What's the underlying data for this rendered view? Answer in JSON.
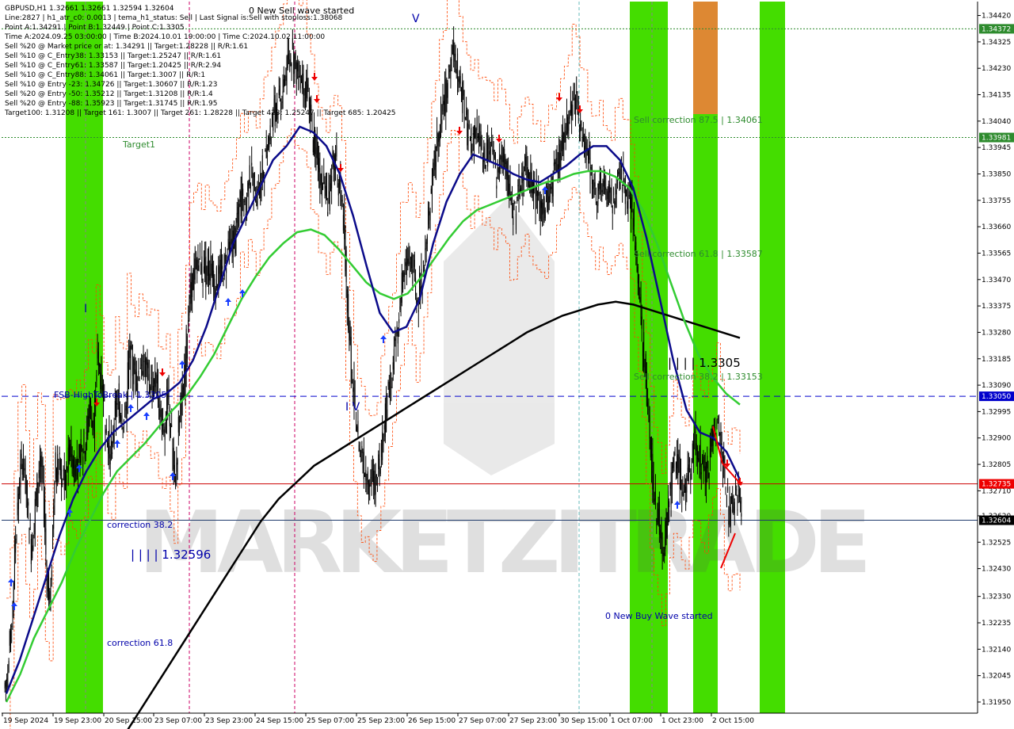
{
  "symbol_header": "GBPUSD,H1  1.32661 1.32661 1.32594 1.32604",
  "info_lines": [
    "Line:2827 | h1_atr_c0: 0.0013 | tema_h1_status: Sell | Last Signal is:Sell with stoploss:1.38068",
    "Point A:1.34291 | Point B:1.32449 | Point C:1.3305",
    "Time A:2024.09.25 03:00:00 | Time B:2024.10.01 19:00:00 | Time C:2024.10.02 11:00:00",
    "Sell %20 @ Market price or at: 1.34291 || Target:1.28228 || R/R:1.61",
    "Sell %10 @ C_Entry38: 1.33153 || Target:1.25247 || R/R:1.61",
    "Sell %10 @ C_Entry61: 1.33587 || Target:1.20425 || R/R:2.94",
    "Sell %10 @ C_Entry88: 1.34061 || Target:1.3007 || R/R:1",
    "Sell %10 @ Entry -23: 1.34726 || Target:1.30607 || R/R:1.23",
    "Sell %20 @ Entry -50: 1.35212 || Target:1.31208 || R/R:1.4",
    "Sell %20 @ Entry -88: 1.35923 || Target:1.31745 || R/R:1.95",
    "Target100: 1.31208 || Target 161: 1.3007 || Target 261: 1.28228 || Target 423: 1.25247 || Target 685: 1.20425"
  ],
  "annotations": {
    "sell_wave": "0 New Sell wave started",
    "buy_wave": "0 New Buy Wave started",
    "target1": "Target1",
    "sell_corr_875": "Sell correction 87.5 | 1.34061",
    "sell_corr_618": "Sell correction 61.8 | 1.33587",
    "sell_corr_382": "Sell correction 38.2 | 1.33153",
    "point_c_label": "| | | | 1.3305",
    "fsb_label": "FSB-HighToBreak | 1.3305",
    "corr_382": "correction 38.2",
    "corr_618": "correction 61.8",
    "low_label": "| | | | 1.32596",
    "wave_v": "V",
    "wave_iv": "I V",
    "wave_i": "I",
    "watermark": "MARKETZITRADE"
  },
  "colors": {
    "green_zone": "#44dd00",
    "orange_zone": "#dd8833",
    "ma_dark_blue": "#0b0b8a",
    "ma_green": "#33cc33",
    "ma_black": "#000000",
    "envelope_orange": "#ff4400",
    "price_line": "#cc0000",
    "fsb_line": "#0000cc",
    "bid_line": "#1f3a6b",
    "arrow_buy": "#1a3fff",
    "arrow_sell": "#ee0000"
  },
  "chart_data": {
    "type": "candlestick",
    "symbol": "GBPUSD",
    "timeframe": "H1",
    "ohlc_last": {
      "open": 1.32661,
      "high": 1.32661,
      "low": 1.32594,
      "close": 1.32604
    },
    "ylim": [
      1.3191,
      1.3447
    ],
    "y_ticks": [
      1.3442,
      1.34325,
      1.3423,
      1.34135,
      1.3404,
      1.33945,
      1.3385,
      1.33755,
      1.3366,
      1.33565,
      1.3347,
      1.33375,
      1.3328,
      1.33185,
      1.3309,
      1.32995,
      1.329,
      1.32805,
      1.3271,
      1.3262,
      1.32525,
      1.3243,
      1.3233,
      1.32235,
      1.3214,
      1.32045,
      1.3195
    ],
    "y_tick_labels": [
      "1.34420",
      "1.34325",
      "1.34230",
      "1.34135",
      "1.34040",
      "1.33945",
      "1.33850",
      "1.33755",
      "1.33660",
      "1.33565",
      "1.33470",
      "1.33375",
      "1.33280",
      "1.33185",
      "1.33090",
      "1.32995",
      "1.32900",
      "1.32805",
      "1.32710",
      "1.32620",
      "1.32525",
      "1.32430",
      "1.32330",
      "1.32235",
      "1.32140",
      "1.32045",
      "1.31950"
    ],
    "x_labels": [
      "19 Sep 2024",
      "19 Sep 23:00",
      "20 Sep 15:00",
      "23 Sep 07:00",
      "23 Sep 23:00",
      "24 Sep 15:00",
      "25 Sep 07:00",
      "25 Sep 23:00",
      "26 Sep 15:00",
      "27 Sep 07:00",
      "27 Sep 23:00",
      "30 Sep 15:00",
      "1 Oct 07:00",
      "1 Oct 23:00",
      "2 Oct 15:00"
    ],
    "price_tags": [
      {
        "label": "1.34372",
        "value": 1.34372,
        "color": "#2e8b2e"
      },
      {
        "label": "1.33981",
        "value": 1.33981,
        "color": "#2e8b2e"
      },
      {
        "label": "1.33050",
        "value": 1.3305,
        "color": "#0000cc"
      },
      {
        "label": "1.32735",
        "value": 1.32735,
        "color": "#ee0000"
      },
      {
        "label": "1.32604",
        "value": 1.32604,
        "color": "#000000"
      }
    ],
    "levels": {
      "target_upper": 1.34372,
      "target1": 1.33981,
      "fsb_high_to_break": 1.3305,
      "red_line": 1.32735,
      "bid": 1.32604
    },
    "swing_points": {
      "point_a": 1.34291,
      "point_b": 1.32449,
      "point_c": 1.3305
    },
    "closes": [
      1.3205,
      1.3225,
      1.3255,
      1.3275,
      1.3285,
      1.3265,
      1.325,
      1.3265,
      1.328,
      1.3275,
      1.324,
      1.3235,
      1.328,
      1.328,
      1.3275,
      1.3278,
      1.3285,
      1.328,
      1.3282,
      1.3285,
      1.329,
      1.33,
      1.3295,
      1.332,
      1.331,
      1.3295,
      1.3285,
      1.329,
      1.3305,
      1.33,
      1.3295,
      1.332,
      1.3315,
      1.331,
      1.3318,
      1.3316,
      1.3312,
      1.3308,
      1.331,
      1.33,
      1.3295,
      1.3305,
      1.329,
      1.3275,
      1.33,
      1.3305,
      1.333,
      1.3345,
      1.335,
      1.3355,
      1.3348,
      1.3352,
      1.335,
      1.3345,
      1.3348,
      1.335,
      1.3355,
      1.3358,
      1.3362,
      1.337,
      1.338,
      1.3375,
      1.3385,
      1.338,
      1.3378,
      1.3385,
      1.339,
      1.3398,
      1.3405,
      1.341,
      1.3412,
      1.342,
      1.3425,
      1.3428,
      1.3422,
      1.342,
      1.3418,
      1.341,
      1.34,
      1.3395,
      1.3385,
      1.338,
      1.3375,
      1.3385,
      1.339,
      1.338,
      1.337,
      1.334,
      1.3315,
      1.33,
      1.3285,
      1.328,
      1.3278,
      1.3275,
      1.3275,
      1.328,
      1.329,
      1.33,
      1.3312,
      1.332,
      1.333,
      1.3345,
      1.335,
      1.3355,
      1.335,
      1.334,
      1.3345,
      1.336,
      1.337,
      1.3385,
      1.3395,
      1.3405,
      1.3412,
      1.342,
      1.343,
      1.3425,
      1.3415,
      1.3405,
      1.34,
      1.3395,
      1.34,
      1.3395,
      1.339,
      1.3392,
      1.3395,
      1.3385,
      1.339,
      1.3392,
      1.3385,
      1.3375,
      1.337,
      1.338,
      1.3385,
      1.339,
      1.3382,
      1.3378,
      1.3375,
      1.3372,
      1.3375,
      1.338,
      1.3385,
      1.339,
      1.3395,
      1.34,
      1.3405,
      1.341,
      1.3408,
      1.34,
      1.3395,
      1.3388,
      1.338,
      1.3378,
      1.3382,
      1.338,
      1.3378,
      1.3375,
      1.338,
      1.3385,
      1.338,
      1.3375,
      1.337,
      1.3355,
      1.334,
      1.332,
      1.33,
      1.328,
      1.3265,
      1.326,
      1.325,
      1.3262,
      1.3275,
      1.3283,
      1.328,
      1.327,
      1.3272,
      1.328,
      1.329,
      1.3285,
      1.328,
      1.3278,
      1.3285,
      1.3292,
      1.3295,
      1.3285,
      1.327,
      1.3262,
      1.3265,
      1.327,
      1.326
    ],
    "dark_blue_ma": [
      1.3198,
      1.321,
      1.3225,
      1.324,
      1.3255,
      1.3268,
      1.3278,
      1.3286,
      1.3292,
      1.3296,
      1.33,
      1.3304,
      1.3306,
      1.331,
      1.3318,
      1.333,
      1.3345,
      1.336,
      1.337,
      1.338,
      1.339,
      1.3395,
      1.3402,
      1.34,
      1.3395,
      1.3385,
      1.337,
      1.3352,
      1.3335,
      1.3328,
      1.333,
      1.334,
      1.336,
      1.3375,
      1.3385,
      1.3392,
      1.339,
      1.3388,
      1.3385,
      1.3383,
      1.3382,
      1.3385,
      1.3388,
      1.3392,
      1.3395,
      1.3395,
      1.339,
      1.338,
      1.3362,
      1.334,
      1.3318,
      1.33,
      1.3292,
      1.329,
      1.3285,
      1.3275
    ],
    "green_ma": [
      1.3195,
      1.3205,
      1.3218,
      1.3228,
      1.3238,
      1.325,
      1.326,
      1.327,
      1.3278,
      1.3283,
      1.3288,
      1.3294,
      1.33,
      1.3305,
      1.3312,
      1.332,
      1.333,
      1.334,
      1.3348,
      1.3355,
      1.336,
      1.3364,
      1.3365,
      1.3363,
      1.3358,
      1.3352,
      1.3346,
      1.3342,
      1.334,
      1.3342,
      1.3348,
      1.3355,
      1.3362,
      1.3368,
      1.3372,
      1.3374,
      1.3376,
      1.3378,
      1.338,
      1.3382,
      1.3383,
      1.3385,
      1.3386,
      1.3386,
      1.3384,
      1.338,
      1.3372,
      1.336,
      1.3346,
      1.3332,
      1.332,
      1.3312,
      1.3306,
      1.3302
    ],
    "black_ma": [
      1.318,
      1.319,
      1.32,
      1.321,
      1.322,
      1.323,
      1.324,
      1.325,
      1.326,
      1.3268,
      1.3274,
      1.328,
      1.3284,
      1.3288,
      1.3292,
      1.3296,
      1.33,
      1.3304,
      1.3308,
      1.3312,
      1.3316,
      1.332,
      1.3324,
      1.3328,
      1.3331,
      1.3334,
      1.3336,
      1.3338,
      1.3339,
      1.3338,
      1.3336,
      1.3334,
      1.3332,
      1.333,
      1.3328,
      1.3326
    ]
  }
}
